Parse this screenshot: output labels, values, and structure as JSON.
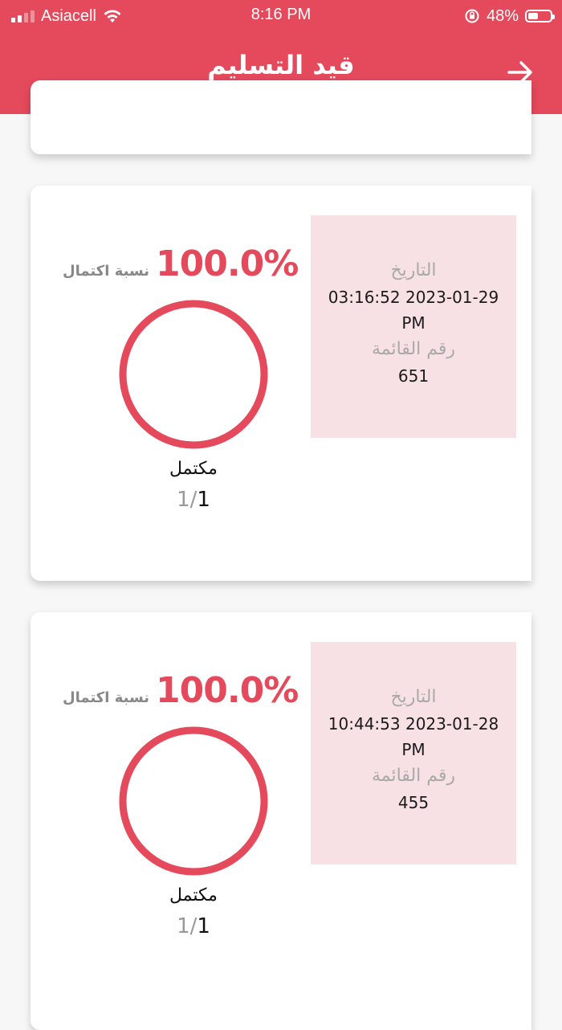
{
  "statusbar": {
    "carrier": "Asiacell",
    "time": "8:16 PM",
    "battery": "48%"
  },
  "header": {
    "title": "قيد التسليم",
    "back_icon": "arrow-right-icon"
  },
  "cards": [
    {
      "date_label": "التاريخ",
      "date_value": "03:16:52 2023-01-29",
      "date_period": "PM",
      "list_label": "رقم القائمة",
      "list_number": "651",
      "completion_label": "نسبة اكتمال",
      "completion_value": "100.0%",
      "completion_fraction": 1.0,
      "status_label": "مكتمل",
      "done_count": "1",
      "total_count": "1/"
    },
    {
      "date_label": "التاريخ",
      "date_value": "10:44:53 2023-01-28",
      "date_period": "PM",
      "list_label": "رقم القائمة",
      "list_number": "455",
      "completion_label": "نسبة اكتمال",
      "completion_value": "100.0%",
      "completion_fraction": 1.0,
      "status_label": "مكتمل",
      "done_count": "1",
      "total_count": "1/"
    }
  ],
  "colors": {
    "accent": "#e4495c",
    "info_bg": "#f8e1e5"
  }
}
